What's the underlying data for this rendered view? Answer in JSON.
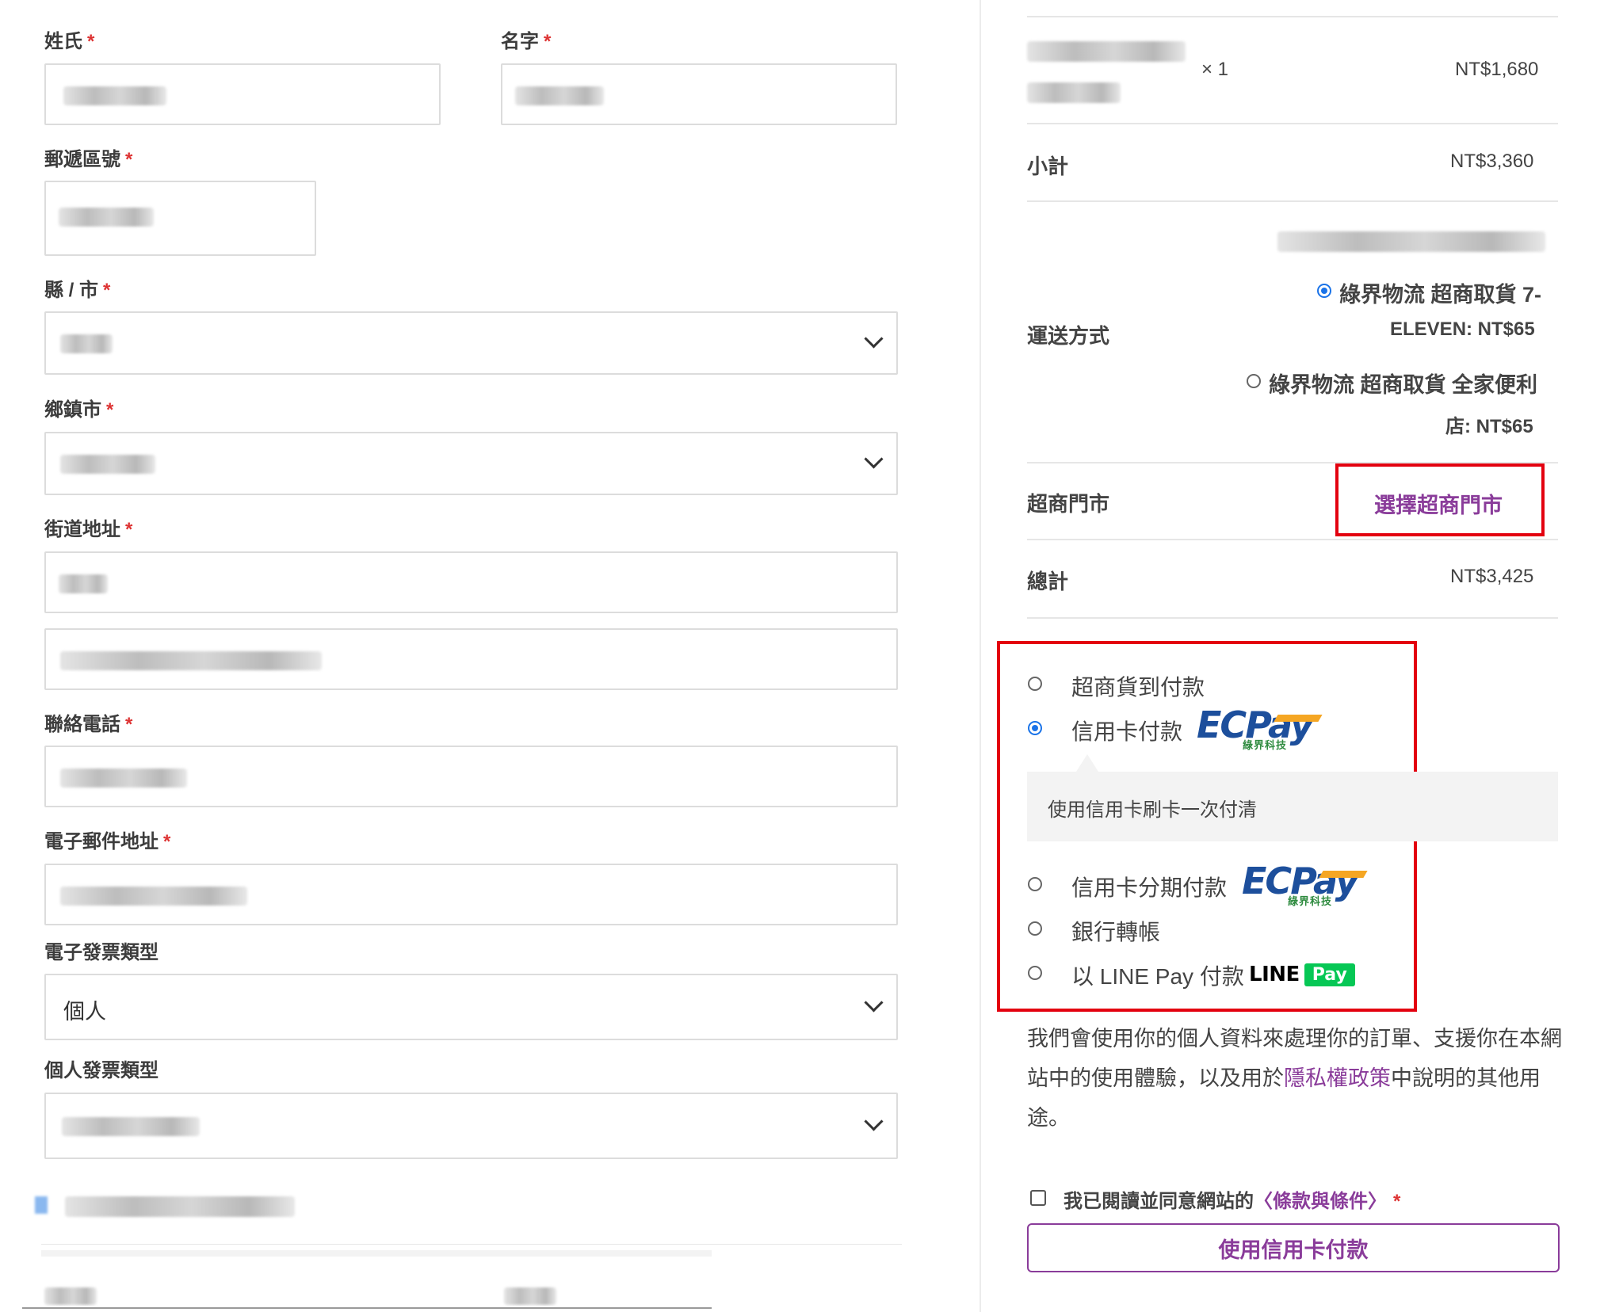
{
  "billing": {
    "last_name_label": "姓氏",
    "first_name_label": "名字",
    "postcode_label": "郵遞區號",
    "county_label": "縣 / 市",
    "township_label": "鄉鎮市",
    "street_label": "街道地址",
    "phone_label": "聯絡電話",
    "email_label": "電子郵件地址",
    "invoice_type_label": "電子發票類型",
    "invoice_type_value": "個人",
    "personal_invoice_label": "個人發票類型",
    "required_mark": "*"
  },
  "order": {
    "item_qty": "× 1",
    "item_price": "NT$1,680",
    "subtotal_label": "小計",
    "subtotal_value": "NT$3,360",
    "shipping_label": "運送方式",
    "shipping_option_1_line1": "綠界物流 超商取貨 7-",
    "shipping_option_1_line2": "ELEVEN: NT$65",
    "shipping_option_2_line1": "綠界物流 超商取貨 全家便利",
    "shipping_option_2_line2": "店: NT$65",
    "store_label": "超商門市",
    "store_button": "選擇超商門市",
    "total_label": "總計",
    "total_value": "NT$3,425"
  },
  "payment": {
    "cod_label": "超商貨到付款",
    "credit_label": "信用卡付款",
    "credit_desc": "使用信用卡刷卡一次付清",
    "installment_label": "信用卡分期付款",
    "bank_label": "銀行轉帳",
    "linepay_label": "以 LINE Pay 付款",
    "ecpay_logo_ec": "EC",
    "ecpay_logo_pay": "Pay",
    "ecpay_logo_sub": "綠界科技",
    "linepay_logo_line": "LINE",
    "linepay_logo_pay": "Pay"
  },
  "privacy": {
    "text_before": "我們會使用你的個人資料來處理你的訂單、支援你在本網站中的使用體驗，以及用於",
    "link": "隱私權政策",
    "text_after": "中說明的其他用途。"
  },
  "terms": {
    "text": "我已閱讀並同意網站的",
    "link": "條款與條件",
    "open_bracket": "〈",
    "close_bracket": "〉",
    "required_mark": "*"
  },
  "submit_button": "使用信用卡付款",
  "colors": {
    "accent_purple": "#8a3c9a",
    "highlight_red": "#e3000f",
    "radio_blue": "#1a73e8",
    "linepay_green": "#06c755"
  },
  "icons": {
    "select_arrow": "chevron-down-icon"
  }
}
